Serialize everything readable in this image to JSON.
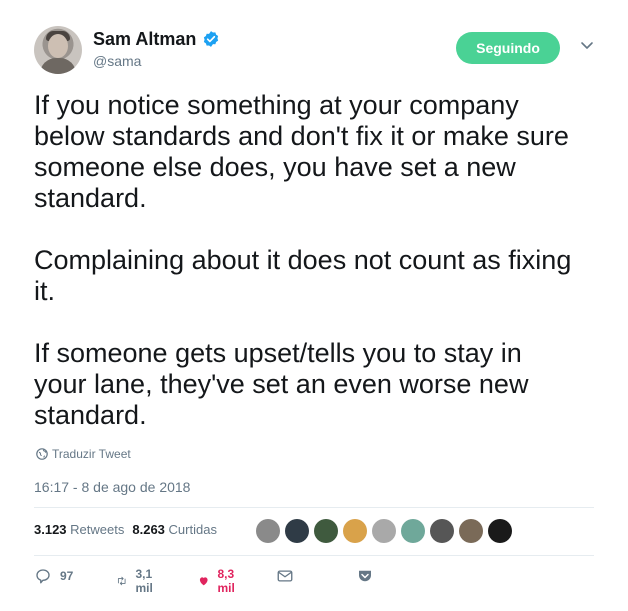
{
  "author": {
    "name": "Sam Altman",
    "handle": "@sama",
    "verified": true
  },
  "follow_button": {
    "label": "Seguindo",
    "color": "#4ad295"
  },
  "tweet": {
    "text": "If you notice something at your company\nbelow standards and don't fix it or make sure\nsomeone else does, you have set a new\nstandard.\n\nComplaining about it does not count as fixing\nit.\n\nIf someone gets upset/tells you to stay in\nyour lane, they've set an even worse new\nstandard.",
    "translate_label": "Traduzir Tweet",
    "timestamp": "16:17 - 8 de ago de 2018"
  },
  "stats": {
    "retweets_count": "3.123",
    "retweets_label": "Retweets",
    "likes_count": "8.263",
    "likes_label": "Curtidas"
  },
  "liker_avatars": [
    {
      "color": "#8a8a8a"
    },
    {
      "color": "#2f3b46"
    },
    {
      "color": "#3f5a3e"
    },
    {
      "color": "#d9a24a"
    },
    {
      "color": "#a9a9a9"
    },
    {
      "color": "#6fa89a"
    },
    {
      "color": "#565656"
    },
    {
      "color": "#7a6a58"
    },
    {
      "color": "#1a1a1a"
    }
  ],
  "actions": {
    "replies": "97",
    "retweets": "3,1 mil",
    "likes": "8,3 mil"
  },
  "colors": {
    "verified": "#1da1f2",
    "like": "#e0245e",
    "muted": "#657786"
  }
}
